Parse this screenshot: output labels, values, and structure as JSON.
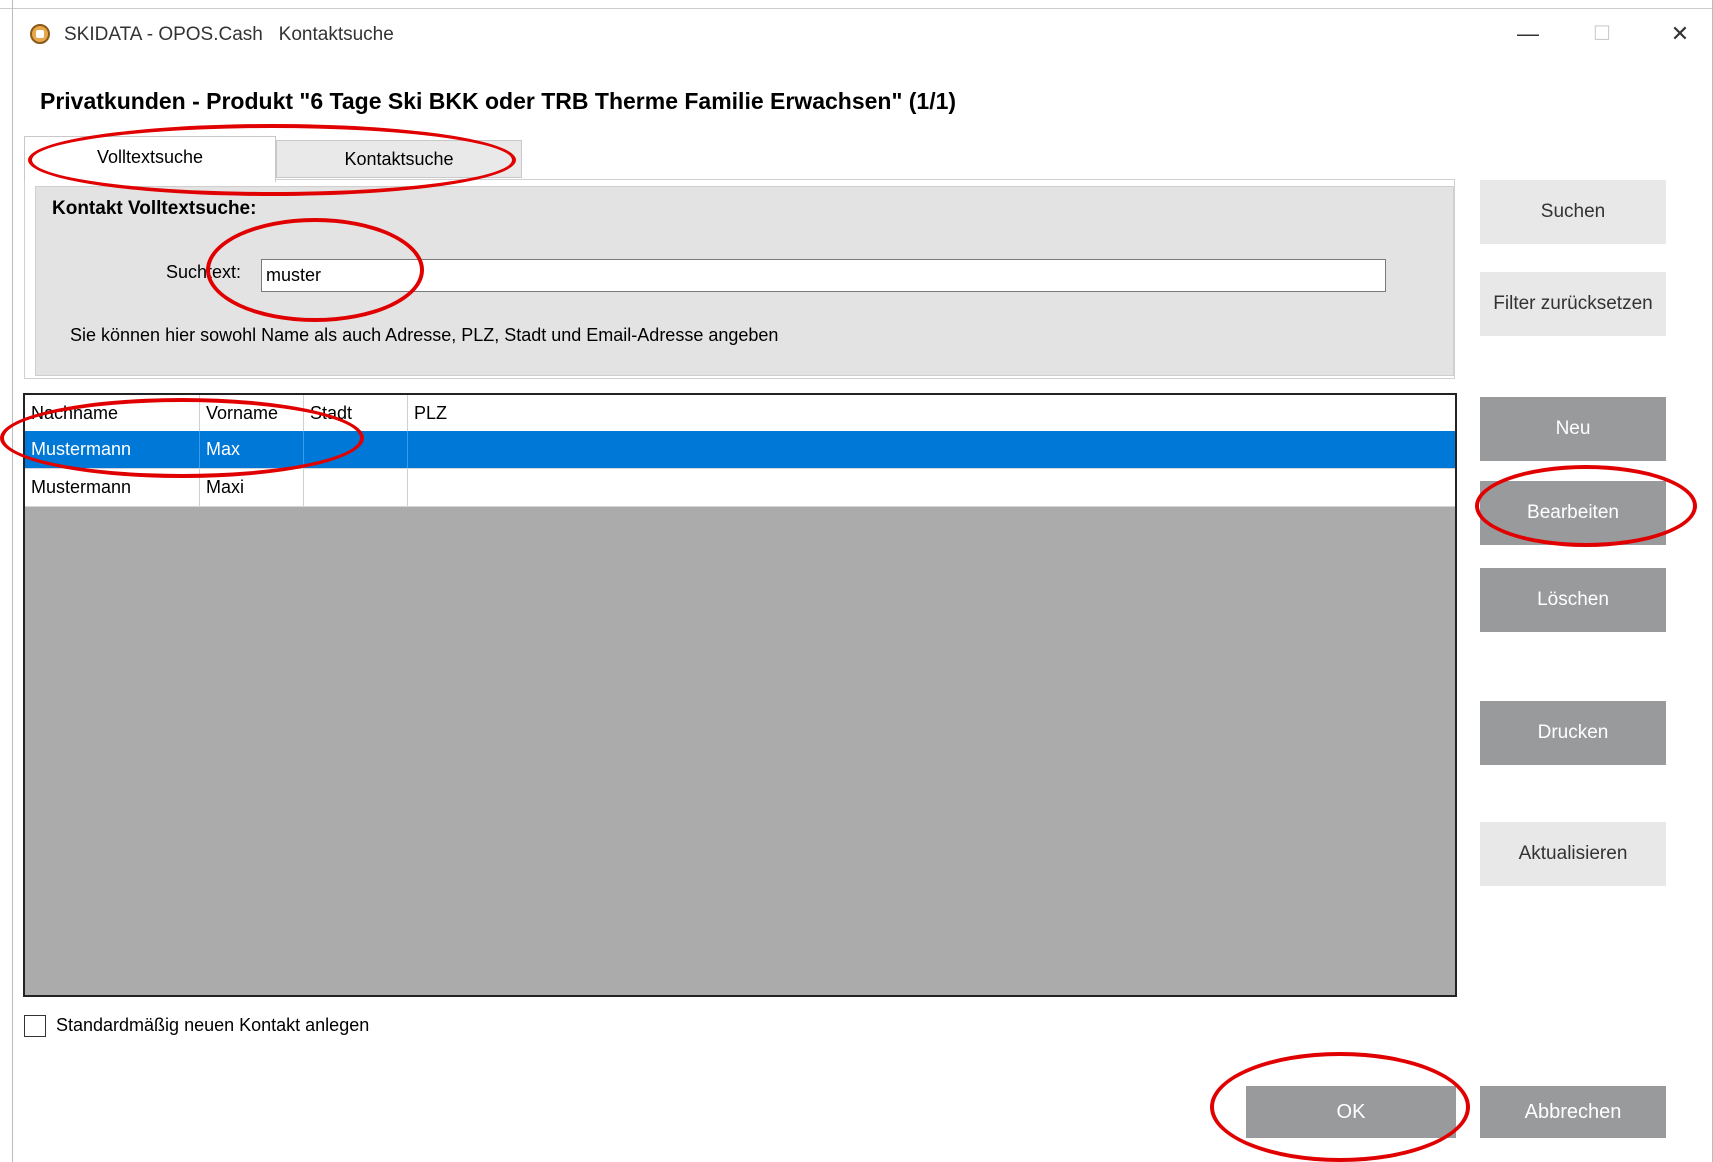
{
  "window": {
    "title": "SKIDATA - OPOS.Cash   Kontaktsuche",
    "minimize": "—",
    "maximize": "☐",
    "close": "✕"
  },
  "page_title": "Privatkunden - Produkt \"6 Tage Ski BKK oder TRB Therme Familie Erwachsen\" (1/1)",
  "tabs": [
    {
      "label": "Volltextsuche",
      "active": true
    },
    {
      "label": "Kontaktsuche",
      "active": false
    }
  ],
  "search": {
    "section_title": "Kontakt Volltextsuche:",
    "label": "Suchtext:",
    "value": "muster",
    "hint": "Sie können hier sowohl Name als auch Adresse, PLZ, Stadt und Email-Adresse angeben"
  },
  "grid": {
    "columns": [
      "Nachname",
      "Vorname",
      "Stadt",
      "PLZ"
    ],
    "rows": [
      {
        "nachname": "Mustermann",
        "vorname": "Max",
        "stadt": "",
        "plz": ""
      },
      {
        "nachname": "Mustermann",
        "vorname": "Maxi",
        "stadt": "",
        "plz": ""
      }
    ],
    "selected_row": 0
  },
  "side_buttons": {
    "search": "Suchen",
    "reset_filter": "Filter zurücksetzen",
    "new": "Neu",
    "edit": "Bearbeiten",
    "delete": "Löschen",
    "print": "Drucken",
    "refresh": "Aktualisieren"
  },
  "default_new_contact": {
    "label": "Standardmäßig neuen Kontakt anlegen",
    "checked": false
  },
  "footer": {
    "ok": "OK",
    "cancel": "Abbrechen"
  },
  "colors": {
    "selection": "#0078d7",
    "button_dark": "#999a9c",
    "button_light": "#e8e8e8",
    "annotation": "#e10000"
  }
}
